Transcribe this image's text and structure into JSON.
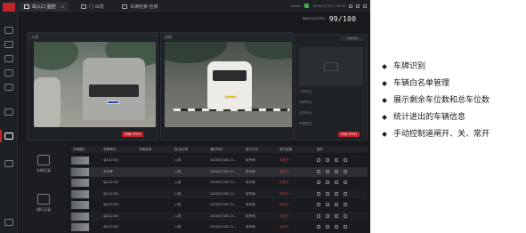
{
  "titlebar": {
    "tabs": [
      {
        "label": "出入口 监控",
        "close": "x"
      },
      {
        "label": "门 出境"
      },
      {
        "label": "车辆检索 检索"
      }
    ],
    "user": "admin",
    "clock": "18:35:07 UTC+08:00"
  },
  "counter": {
    "label": "剩余车位/总车位",
    "value": "99/100"
  },
  "cameras": [
    {
      "label": "入场"
    },
    {
      "label": "出场"
    }
  ],
  "side": {
    "header": "车辆详情",
    "rows": [
      "入场时间",
      "车牌号码",
      "出场时间",
      "车辆类型"
    ]
  },
  "buttons": {
    "left_open": "开闸 OPEN",
    "right_open": "开闸 OPEN"
  },
  "left_tabs": [
    {
      "label": "车辆记录"
    },
    {
      "label": "通行记录"
    }
  ],
  "table": {
    "columns": [
      "车辆图片",
      "车牌号码",
      "车辆名单",
      "进/出出场",
      "通行时间",
      "放行方式",
      "放行结果",
      "操作"
    ],
    "rows": [
      {
        "plate": "京A12345",
        "list": "",
        "direction": "入场",
        "time": "2020/07/28 13...",
        "mode": "未开闸",
        "result": "未放行"
      },
      {
        "plate": "无车牌",
        "list": "",
        "direction": "入场",
        "time": "2020/07/28 13...",
        "mode": "未开闸",
        "result": "未放行"
      },
      {
        "plate": "京A12345",
        "list": "",
        "direction": "入场",
        "time": "2020/07/28 13...",
        "mode": "未开闸",
        "result": "未放行"
      },
      {
        "plate": "京A12345",
        "list": "",
        "direction": "入场",
        "time": "2020/07/28 13...",
        "mode": "未开闸",
        "result": "未放行"
      },
      {
        "plate": "京A12345",
        "list": "",
        "direction": "入场",
        "time": "2020/07/28 13...",
        "mode": "未开闸",
        "result": "未放行"
      },
      {
        "plate": "京A12345",
        "list": "",
        "direction": "入场",
        "time": "2020/07/28 13...",
        "mode": "未开闸",
        "result": "未放行"
      },
      {
        "plate": "京A12345",
        "list": "",
        "direction": "入场",
        "time": "2020/07/28 13...",
        "mode": "未开闸",
        "result": "未放行"
      }
    ]
  },
  "features": [
    "车牌识别",
    "车辆白名单管理",
    "展示剩余车位数和总车位数",
    "统计进出的车辆信息",
    "手动控制道闸开、关、常开"
  ],
  "colors": {
    "accent": "#c0242d",
    "app_bg": "#17191c",
    "status_red": "#d23b3b"
  }
}
